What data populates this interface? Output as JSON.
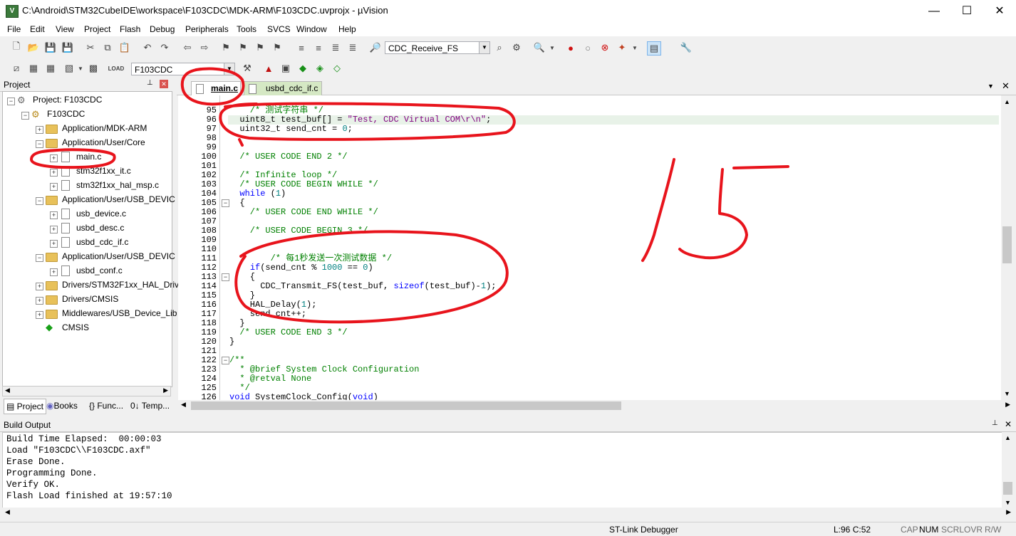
{
  "window": {
    "title": "C:\\Android\\STM32CubeIDE\\workspace\\F103CDC\\MDK-ARM\\F103CDC.uvprojx - µVision",
    "minimize": "—",
    "maximize": "☐",
    "close": "✕"
  },
  "menu": [
    "File",
    "Edit",
    "View",
    "Project",
    "Flash",
    "Debug",
    "Peripherals",
    "Tools",
    "SVCS",
    "Window",
    "Help"
  ],
  "toolbar": {
    "find_combo": "CDC_Receive_FS",
    "target_combo": "F103CDC"
  },
  "project_panel": {
    "title": "Project",
    "pin": "📌",
    "close": "✕",
    "tree": [
      {
        "label": "Project: F103CDC",
        "kind": "root"
      },
      {
        "label": "F103CDC",
        "kind": "target"
      },
      {
        "label": "Application/MDK-ARM",
        "kind": "folder"
      },
      {
        "label": "Application/User/Core",
        "kind": "folder"
      },
      {
        "label": "main.c",
        "kind": "file"
      },
      {
        "label": "stm32f1xx_it.c",
        "kind": "file"
      },
      {
        "label": "stm32f1xx_hal_msp.c",
        "kind": "file"
      },
      {
        "label": "Application/User/USB_DEVIC",
        "kind": "folder"
      },
      {
        "label": "usb_device.c",
        "kind": "file"
      },
      {
        "label": "usbd_desc.c",
        "kind": "file"
      },
      {
        "label": "usbd_cdc_if.c",
        "kind": "file"
      },
      {
        "label": "Application/User/USB_DEVIC",
        "kind": "folder"
      },
      {
        "label": "usbd_conf.c",
        "kind": "file"
      },
      {
        "label": "Drivers/STM32F1xx_HAL_Driv",
        "kind": "folder"
      },
      {
        "label": "Drivers/CMSIS",
        "kind": "folder"
      },
      {
        "label": "Middlewares/USB_Device_Lib",
        "kind": "folder"
      },
      {
        "label": "CMSIS",
        "kind": "component"
      }
    ],
    "tabs": [
      "Project",
      "Books",
      "{} Func...",
      "0↓ Temp..."
    ]
  },
  "editor": {
    "tabs": [
      "main.c",
      "usbd_cdc_if.c"
    ],
    "lines": [
      {
        "n": "95",
        "text": "    /* 测试字符串 */"
      },
      {
        "n": "96",
        "text": "  uint8_t test_buf[] = \"Test, CDC Virtual COM\\r\\n\";"
      },
      {
        "n": "97",
        "text": "  uint32_t send_cnt = 0;"
      },
      {
        "n": "98",
        "text": ""
      },
      {
        "n": "99",
        "text": ""
      },
      {
        "n": "100",
        "text": "  /* USER CODE END 2 */"
      },
      {
        "n": "101",
        "text": ""
      },
      {
        "n": "102",
        "text": "  /* Infinite loop */"
      },
      {
        "n": "103",
        "text": "  /* USER CODE BEGIN WHILE */"
      },
      {
        "n": "104",
        "text": "  while (1)"
      },
      {
        "n": "105",
        "text": "  {"
      },
      {
        "n": "106",
        "text": "    /* USER CODE END WHILE */"
      },
      {
        "n": "107",
        "text": ""
      },
      {
        "n": "108",
        "text": "    /* USER CODE BEGIN 3 */"
      },
      {
        "n": "109",
        "text": ""
      },
      {
        "n": "110",
        "text": ""
      },
      {
        "n": "111",
        "text": "        /* 每1秒发送一次测试数据 */"
      },
      {
        "n": "112",
        "text": "    if(send_cnt % 1000 == 0)"
      },
      {
        "n": "113",
        "text": "    {"
      },
      {
        "n": "114",
        "text": "      CDC_Transmit_FS(test_buf, sizeof(test_buf)-1);"
      },
      {
        "n": "115",
        "text": "    }"
      },
      {
        "n": "116",
        "text": "    HAL_Delay(1);"
      },
      {
        "n": "117",
        "text": "    send_cnt++;"
      },
      {
        "n": "118",
        "text": "  }"
      },
      {
        "n": "119",
        "text": "  /* USER CODE END 3 */"
      },
      {
        "n": "120",
        "text": "}"
      },
      {
        "n": "121",
        "text": ""
      },
      {
        "n": "122",
        "text": "/**"
      },
      {
        "n": "123",
        "text": "  * @brief System Clock Configuration"
      },
      {
        "n": "124",
        "text": "  * @retval None"
      },
      {
        "n": "125",
        "text": "  */"
      },
      {
        "n": "126",
        "text": "void SystemClock_Config(void)"
      }
    ]
  },
  "annotation_text": "15",
  "build_output": {
    "title": "Build Output",
    "lines": [
      "Build Time Elapsed:  00:00:03",
      "Load \"F103CDC\\\\F103CDC.axf\"",
      "Erase Done.",
      "Programming Done.",
      "Verify OK.",
      "Flash Load finished at 19:57:10"
    ]
  },
  "status": {
    "debugger": "ST-Link Debugger",
    "position": "L:96 C:52",
    "cap": "CAP",
    "num": "NUM",
    "scrl": "SCRL",
    "ovr": "OVR",
    "rw": "R/W"
  },
  "colors": {
    "annotation": "#e8141c",
    "comment": "#008000",
    "keyword": "#0000ff",
    "number": "#008080"
  }
}
